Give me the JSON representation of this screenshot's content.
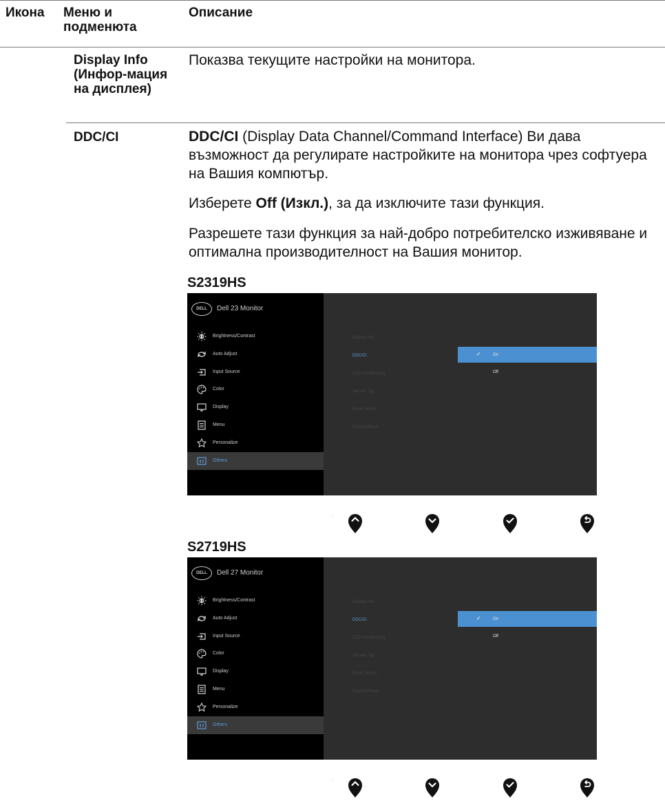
{
  "header": {
    "icon_col": "Икона",
    "menu_col": "Меню и подменюта",
    "desc_col": "Описание"
  },
  "rows": [
    {
      "menu": "Display Info (Инфор-мация на дисплея)",
      "description": "Показва текущите настройки на монитора."
    },
    {
      "menu": "DDC/CI",
      "p1_bold": "DDC/CI",
      "p1_rest": " (Display Data Channel/Command Interface) Ви дава възможност да регулирате настройките на монитора чрез софтуера на Вашия компютър.",
      "p2_pre": "Изберете ",
      "p2_bold": "Off (Изкл.)",
      "p2_post": ", за да изключите тази функция.",
      "p3": "Разрешете тази функция за най-добро потребителско изживяване и оптимална производителност на Вашия монитор."
    }
  ],
  "osd_screens": [
    {
      "model": "S2319HS",
      "logo": "DELL",
      "title": "Dell 23 Monitor"
    },
    {
      "model": "S2719HS",
      "logo": "DELL",
      "title": "Dell 27 Monitor"
    }
  ],
  "osd_menu": [
    {
      "label": "Brightness/Contrast",
      "icon": "brightness-icon"
    },
    {
      "label": "Auto Adjust",
      "icon": "auto-adjust-icon"
    },
    {
      "label": "Input Source",
      "icon": "input-source-icon"
    },
    {
      "label": "Color",
      "icon": "color-icon"
    },
    {
      "label": "Display",
      "icon": "display-icon"
    },
    {
      "label": "Menu",
      "icon": "menu-icon"
    },
    {
      "label": "Personalize",
      "icon": "star-icon"
    },
    {
      "label": "Others",
      "icon": "others-icon",
      "active": true
    }
  ],
  "osd_submenu": [
    "Display Info",
    "DDC/CI",
    "LCD Conditioning",
    "Service Tag",
    "Reset Others",
    "Factory Reset"
  ],
  "osd_options": [
    "On",
    "Off"
  ],
  "colors": {
    "osd_background": "#2d2d2d",
    "osd_left_panel": "#000000",
    "highlight_blue": "#4b91d1",
    "active_text_blue": "#5e9bd6"
  },
  "nav_buttons": [
    "up-icon",
    "down-icon",
    "check-icon",
    "back-icon"
  ]
}
